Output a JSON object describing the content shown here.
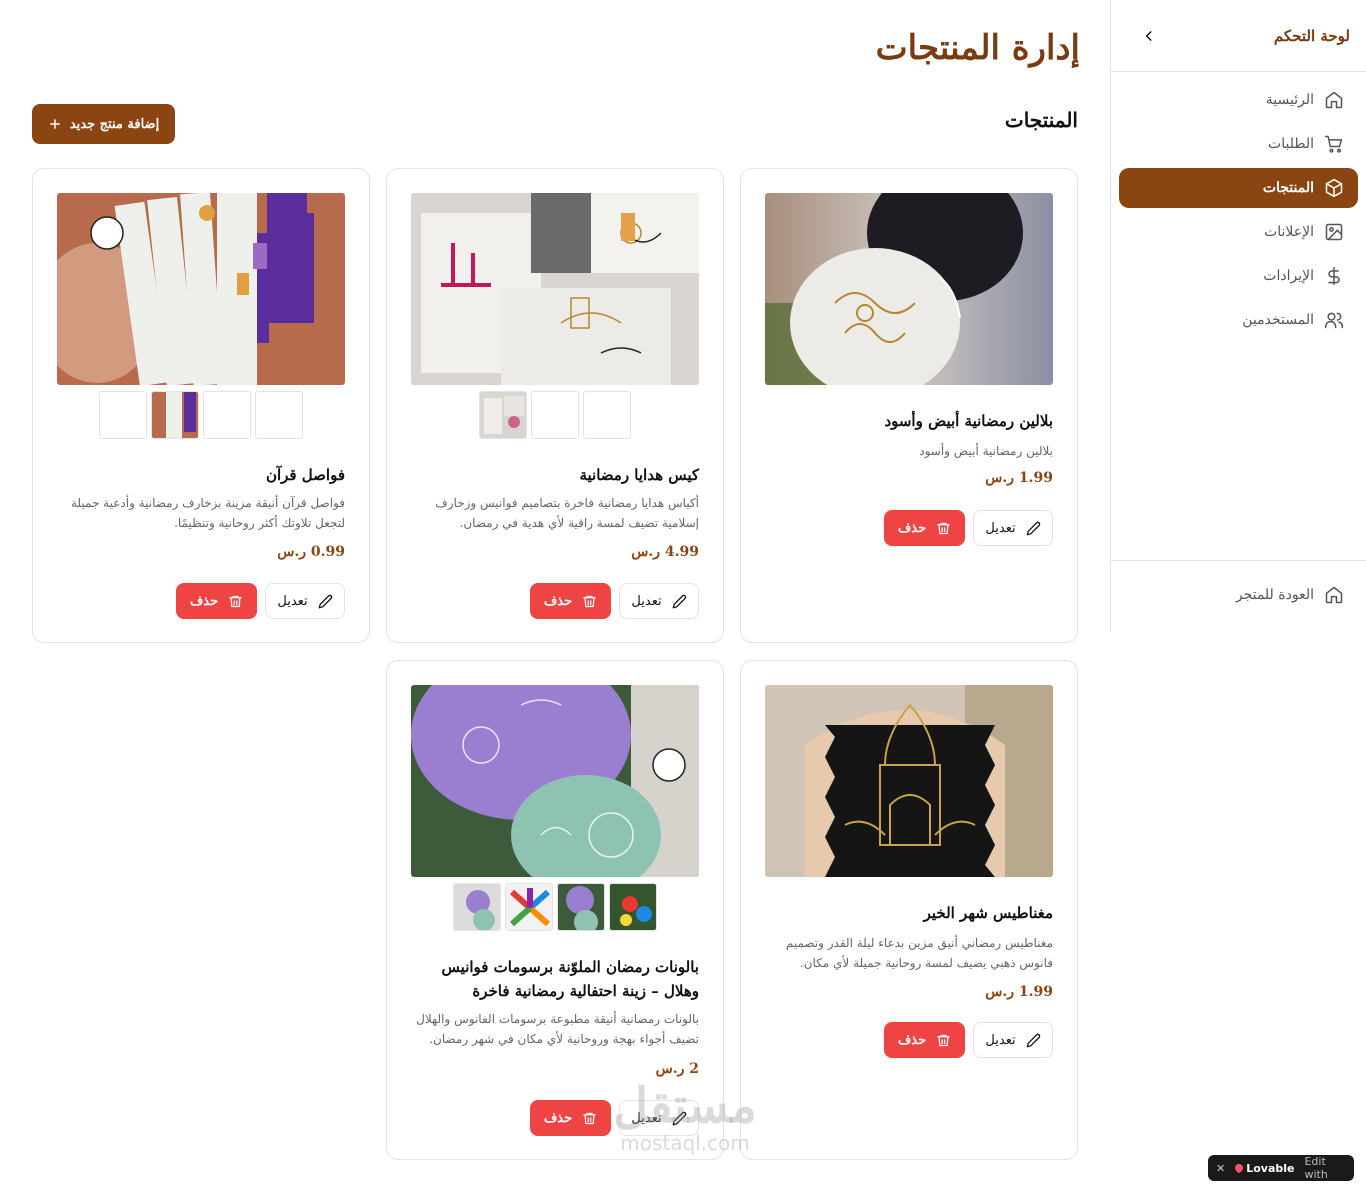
{
  "sidebar": {
    "title": "لوحة التحكم",
    "items": [
      {
        "label": "الرئيسية",
        "icon": "home-icon"
      },
      {
        "label": "الطلبات",
        "icon": "cart-icon"
      },
      {
        "label": "المنتجات",
        "icon": "package-icon",
        "active": true
      },
      {
        "label": "الإعلانات",
        "icon": "image-icon"
      },
      {
        "label": "الإيرادات",
        "icon": "dollar-icon"
      },
      {
        "label": "المستخدمين",
        "icon": "users-icon"
      }
    ],
    "back_label": "العودة للمتجر"
  },
  "header": {
    "title": "إدارة المنتجات",
    "section_title": "المنتجات",
    "add_label": "إضافة منتج جديد"
  },
  "actions": {
    "edit": "تعديل",
    "delete": "حذف"
  },
  "products": [
    {
      "name": "بلالين رمضانية أبيض وأسود",
      "description": "بلالين رمضانية أبيض وأسود",
      "price": "1.99 ر.س"
    },
    {
      "name": "كيس هدايا رمضانية",
      "description": "أكياس هدايا رمضانية فاخرة بتصاميم فوانيس وزخارف إسلامية تضيف لمسة راقية لأي هدية في رمضان.",
      "price": "4.99 ر.س"
    },
    {
      "name": "فواصل قرآن",
      "description": "فواصل قرآن أنيقة مزينة بزخارف رمضانية وأدعية جميلة لتجعل تلاوتك أكثر روحانية وتنظيمًا.",
      "price": "0.99 ر.س"
    },
    {
      "name": "مغناطيس شهر الخير",
      "description": "مغناطيس رمضاني أنيق مزين بدعاء ليلة القدر وتصميم فانوس ذهبي يضيف لمسة روحانية جميلة لأي مكان.",
      "price": "1.99 ر.س"
    },
    {
      "name": "بالونات رمضان الملوّنة برسومات فوانيس وهلال – زينة احتفالية رمضانية فاخرة",
      "description": "بالونات رمضانية أنيقة مطبوعة برسومات الفانوس والهلال تضيف أجواء بهجة وروحانية لأي مكان في شهر رمضان.",
      "price": "2 ر.س"
    }
  ],
  "watermark": {
    "arabic": "مستقل",
    "latin": "mostaql.com"
  },
  "lovable": {
    "close": "✕",
    "brand": "Lovable",
    "text": "Edit with"
  },
  "colors": {
    "brand": "#8b4513",
    "danger": "#ef4444"
  }
}
